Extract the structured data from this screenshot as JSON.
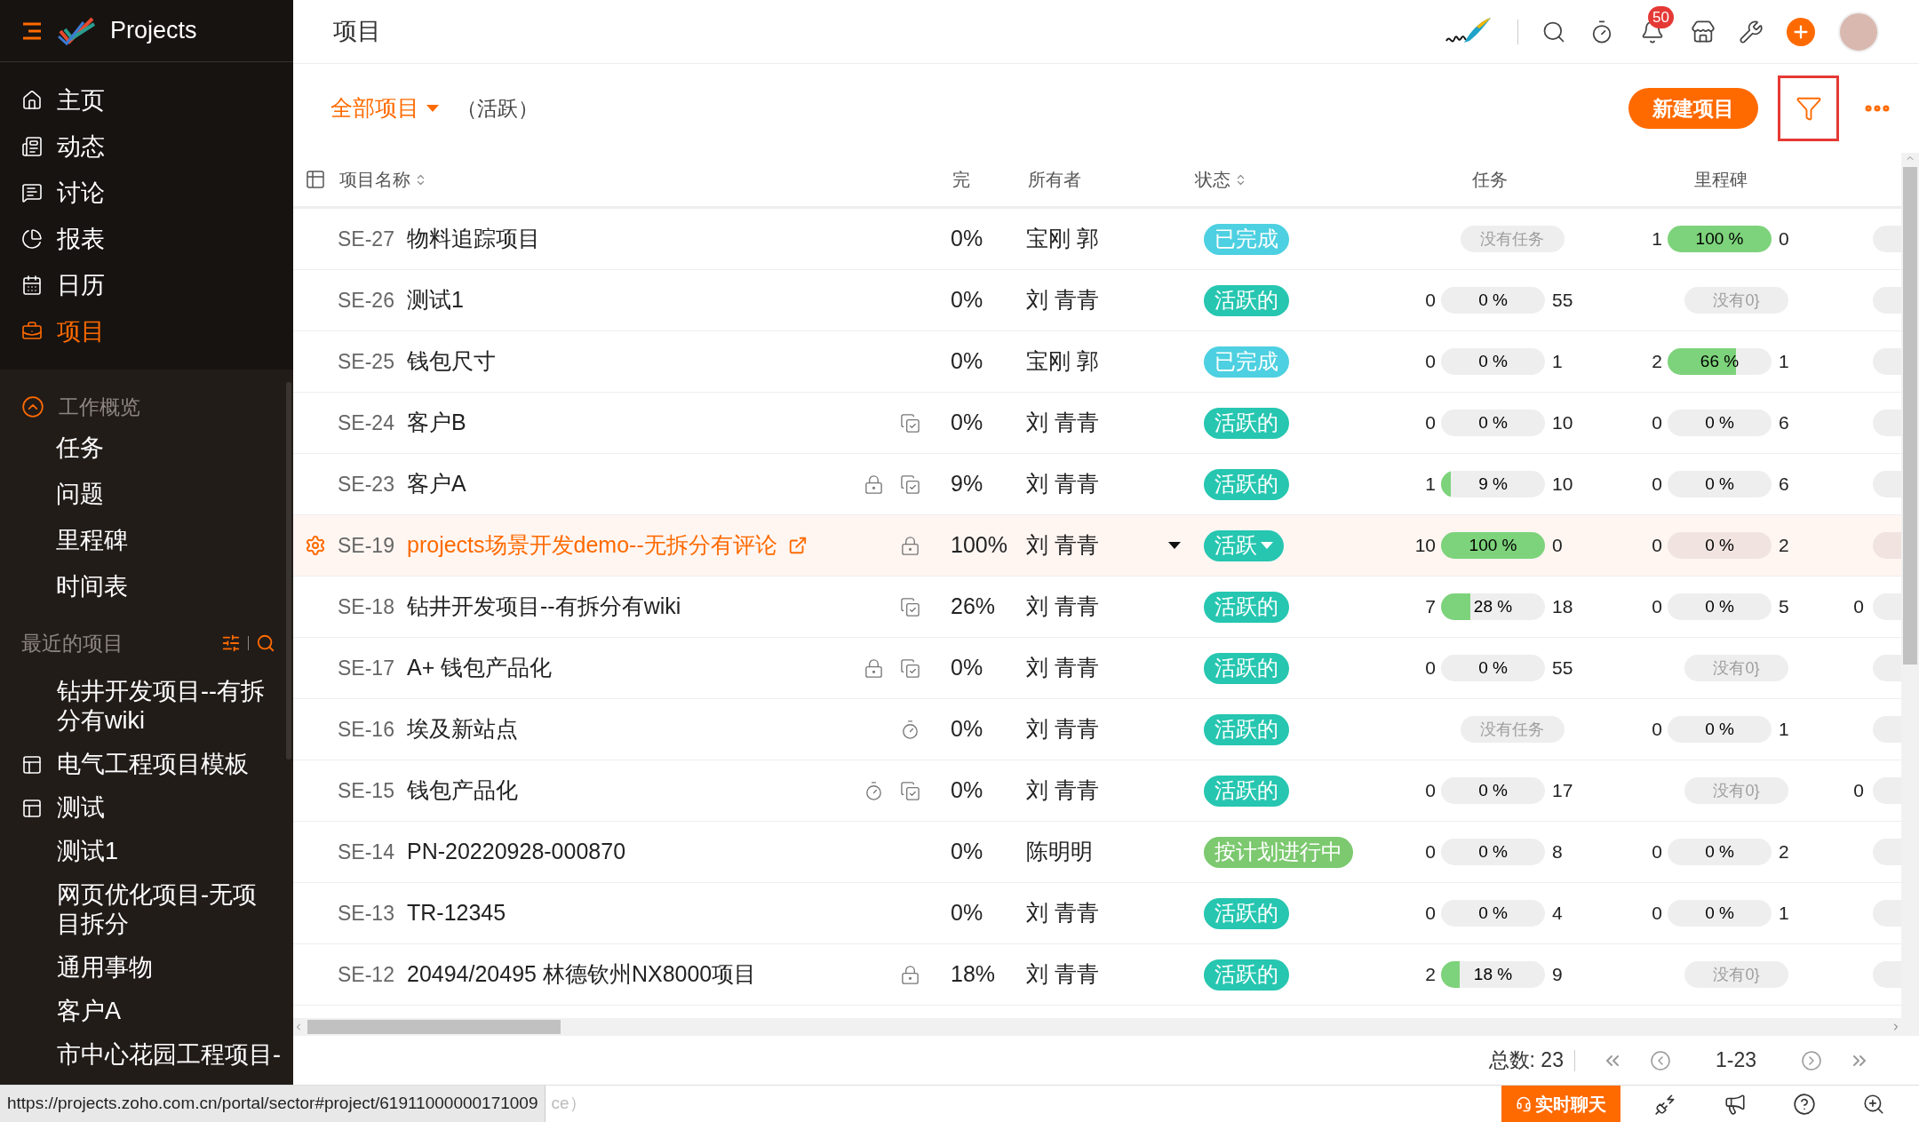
{
  "app": {
    "title": "Projects"
  },
  "sidebar": {
    "nav": [
      {
        "label": "主页",
        "selected": false
      },
      {
        "label": "动态",
        "selected": false
      },
      {
        "label": "讨论",
        "selected": false
      },
      {
        "label": "报表",
        "selected": false
      },
      {
        "label": "日历",
        "selected": false
      },
      {
        "label": "项目",
        "selected": true
      }
    ],
    "overview": {
      "title": "工作概览",
      "expanded": true,
      "items": [
        "任务",
        "问题",
        "里程碑",
        "时间表"
      ]
    },
    "recent": {
      "title": "最近的项目",
      "items": [
        {
          "label": "钻井开发项目--有拆分有wiki",
          "template": false
        },
        {
          "label": "电气工程项目模板",
          "template": true
        },
        {
          "label": "测试",
          "template": true
        },
        {
          "label": "测试1",
          "template": false
        },
        {
          "label": "网页优化项目-无项目拆分",
          "template": false
        },
        {
          "label": "通用事物",
          "template": false
        },
        {
          "label": "客户A",
          "template": false
        },
        {
          "label": "市中心花园工程项目-",
          "template": false
        }
      ]
    }
  },
  "header": {
    "title": "项目",
    "notifications": "50"
  },
  "toolbar": {
    "view": "全部项目",
    "filter_label": "（活跃）",
    "new_button": "新建项目",
    "filter_selected": true
  },
  "table": {
    "columns": [
      {
        "label": "项目名称",
        "sortable": true
      },
      {
        "label": "完"
      },
      {
        "label": "所有者"
      },
      {
        "label": "状态",
        "sortable": true
      },
      {
        "label": "任务"
      },
      {
        "label": "里程碑"
      }
    ],
    "rows": [
      {
        "id": "SE-27",
        "name": "物料追踪项目",
        "icons": [],
        "completion": "0%",
        "owner": "宝刚 郭",
        "status": {
          "label": "已完成",
          "color": "#4dd0e1",
          "dropdown": false
        },
        "tasks": {
          "kind": "empty",
          "label": "没有任务"
        },
        "milestones": {
          "kind": "progress",
          "open": "1",
          "level": 1,
          "percent": "100 %",
          "closed": "0"
        },
        "selected": false
      },
      {
        "id": "SE-26",
        "name": "测试1",
        "icons": [],
        "completion": "0%",
        "owner": "刘 青青",
        "status": {
          "label": "活跃的",
          "color": "#26c6b0",
          "dropdown": false
        },
        "tasks": {
          "kind": "progress",
          "open": "0",
          "level": 0,
          "percent": "0 %",
          "closed": "55"
        },
        "milestones": {
          "kind": "empty",
          "label": "没有0}"
        },
        "selected": false
      },
      {
        "id": "SE-25",
        "name": "钱包尺寸",
        "icons": [],
        "completion": "0%",
        "owner": "宝刚 郭",
        "status": {
          "label": "已完成",
          "color": "#4dd0e1",
          "dropdown": false
        },
        "tasks": {
          "kind": "progress",
          "open": "0",
          "level": 0,
          "percent": "0 %",
          "closed": "1"
        },
        "milestones": {
          "kind": "progress",
          "open": "2",
          "level": 0.66,
          "percent": "66 %",
          "closed": "1"
        },
        "selected": false
      },
      {
        "id": "SE-24",
        "name": "客户B",
        "icons": [
          {
            "kind": "check"
          }
        ],
        "completion": "0%",
        "owner": "刘 青青",
        "status": {
          "label": "活跃的",
          "color": "#26c6b0",
          "dropdown": false
        },
        "tasks": {
          "kind": "progress",
          "open": "0",
          "level": 0,
          "percent": "0 %",
          "closed": "10"
        },
        "milestones": {
          "kind": "progress",
          "open": "0",
          "level": 0,
          "percent": "0 %",
          "closed": "6"
        },
        "selected": false
      },
      {
        "id": "SE-23",
        "name": "客户A",
        "icons": [
          {
            "kind": "lock"
          },
          {
            "kind": "check"
          }
        ],
        "completion": "9%",
        "owner": "刘 青青",
        "status": {
          "label": "活跃的",
          "color": "#26c6b0",
          "dropdown": false
        },
        "tasks": {
          "kind": "progress",
          "open": "1",
          "level": 0.09,
          "percent": "9 %",
          "closed": "10"
        },
        "milestones": {
          "kind": "progress",
          "open": "0",
          "level": 0,
          "percent": "0 %",
          "closed": "6"
        },
        "selected": false
      },
      {
        "id": "SE-19",
        "name": "projects场景开发demo--无拆分有评论",
        "icons": [
          {
            "kind": "lock"
          }
        ],
        "completion": "100%",
        "owner": "刘 青青",
        "status": {
          "label": "活跃",
          "color": "#26c6b0",
          "dropdown": true
        },
        "tasks": {
          "kind": "progress",
          "open": "10",
          "level": 1,
          "percent": "100 %",
          "closed": "0"
        },
        "milestones": {
          "kind": "progress",
          "open": "0",
          "level": 0,
          "percent": "0 %",
          "closed": "2"
        },
        "selected": true
      },
      {
        "id": "SE-18",
        "name": "钻井开发项目--有拆分有wiki",
        "icons": [
          {
            "kind": "check"
          }
        ],
        "completion": "26%",
        "owner": "刘 青青",
        "status": {
          "label": "活跃的",
          "color": "#26c6b0",
          "dropdown": false
        },
        "tasks": {
          "kind": "progress",
          "open": "7",
          "level": 0.28,
          "percent": "28 %",
          "closed": "18"
        },
        "milestones": {
          "kind": "progress",
          "open": "0",
          "level": 0,
          "percent": "0 %",
          "closed": "5"
        },
        "column_7": "0",
        "selected": false
      },
      {
        "id": "SE-17",
        "name": "A+ 钱包产品化",
        "icons": [
          {
            "kind": "lock"
          },
          {
            "kind": "check"
          }
        ],
        "completion": "0%",
        "owner": "刘 青青",
        "status": {
          "label": "活跃的",
          "color": "#26c6b0",
          "dropdown": false
        },
        "tasks": {
          "kind": "progress",
          "open": "0",
          "level": 0,
          "percent": "0 %",
          "closed": "55"
        },
        "milestones": {
          "kind": "empty",
          "label": "没有0}"
        },
        "selected": false
      },
      {
        "id": "SE-16",
        "name": "埃及新站点",
        "icons": [
          {
            "kind": "timer"
          }
        ],
        "completion": "0%",
        "owner": "刘 青青",
        "status": {
          "label": "活跃的",
          "color": "#26c6b0",
          "dropdown": false
        },
        "tasks": {
          "kind": "empty",
          "label": "没有任务"
        },
        "milestones": {
          "kind": "progress",
          "open": "0",
          "level": 0,
          "percent": "0 %",
          "closed": "1"
        },
        "selected": false
      },
      {
        "id": "SE-15",
        "name": "钱包产品化",
        "icons": [
          {
            "kind": "timer"
          },
          {
            "kind": "check"
          }
        ],
        "completion": "0%",
        "owner": "刘 青青",
        "status": {
          "label": "活跃的",
          "color": "#26c6b0",
          "dropdown": false
        },
        "tasks": {
          "kind": "progress",
          "open": "0",
          "level": 0,
          "percent": "0 %",
          "closed": "17"
        },
        "milestones": {
          "kind": "empty",
          "label": "没有0}"
        },
        "column_7": "0",
        "selected": false
      },
      {
        "id": "SE-14",
        "name": "PN-20220928-000870",
        "icons": [],
        "completion": "0%",
        "owner": "陈明明",
        "status": {
          "label": "按计划进行中",
          "color": "#7cc96f",
          "dropdown": false
        },
        "tasks": {
          "kind": "progress",
          "open": "0",
          "level": 0,
          "percent": "0 %",
          "closed": "8"
        },
        "milestones": {
          "kind": "progress",
          "open": "0",
          "level": 0,
          "percent": "0 %",
          "closed": "2"
        },
        "selected": false
      },
      {
        "id": "SE-13",
        "name": "TR-12345",
        "icons": [],
        "completion": "0%",
        "owner": "刘 青青",
        "status": {
          "label": "活跃的",
          "color": "#26c6b0",
          "dropdown": false
        },
        "tasks": {
          "kind": "progress",
          "open": "0",
          "level": 0,
          "percent": "0 %",
          "closed": "4"
        },
        "milestones": {
          "kind": "progress",
          "open": "0",
          "level": 0,
          "percent": "0 %",
          "closed": "1"
        },
        "selected": false
      },
      {
        "id": "SE-12",
        "name": "20494/20495 林德钦州NX8000项目",
        "icons": [
          {
            "kind": "lock"
          }
        ],
        "completion": "18%",
        "owner": "刘 青青",
        "status": {
          "label": "活跃的",
          "color": "#26c6b0",
          "dropdown": false
        },
        "tasks": {
          "kind": "progress",
          "open": "2",
          "level": 0.18,
          "percent": "18 %",
          "closed": "9"
        },
        "milestones": {
          "kind": "empty",
          "label": "没有0}"
        },
        "selected": false
      }
    ]
  },
  "pagination": {
    "total": "总数: 23",
    "range": "1-23"
  },
  "status_bar": {
    "url": "https://projects.zoho.com.cn/portal/sector#project/61911000000171009",
    "partial_text": "ce）",
    "chat_button": "实时聊天"
  }
}
